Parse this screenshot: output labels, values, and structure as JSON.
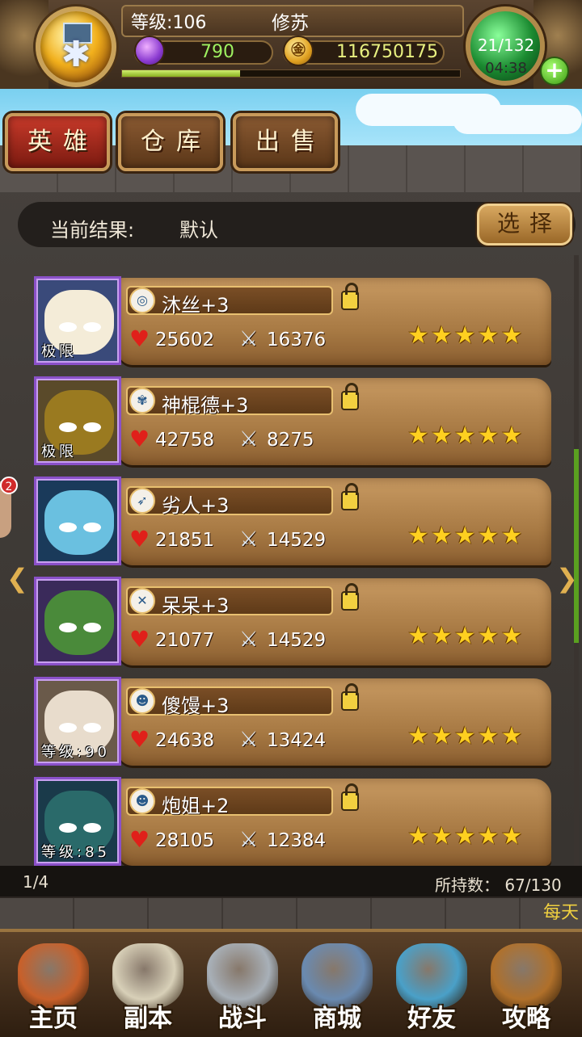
{
  "header": {
    "level_text": "等级:106",
    "player_name": "修苏",
    "gems": "790",
    "gold": "116750175",
    "gold_symbol": "㊎",
    "exp_fraction": 0.35,
    "stamina": "21/132",
    "stamina_timer": "04:38",
    "plus_label": "+",
    "medal_icon": "snowflake-medal-icon"
  },
  "tabs": [
    {
      "label": "英雄",
      "active": true
    },
    {
      "label": "仓库",
      "active": false
    },
    {
      "label": "出售",
      "active": false
    }
  ],
  "filter": {
    "label": "当前结果:",
    "value": "默认",
    "select_label": "选择"
  },
  "heroes": [
    {
      "name": "沐丝+3",
      "hp": "25602",
      "atk": "16376",
      "stars": "★★★★★",
      "tag": "极限",
      "class_icon": "spirit-icon",
      "class_glyph": "◎",
      "face_color": "#f4ecd8",
      "bg_color": "#3a4a7a"
    },
    {
      "name": "神棍德+3",
      "hp": "42758",
      "atk": "8275",
      "stars": "★★★★★",
      "tag": "极限",
      "class_icon": "paw-icon",
      "class_glyph": "✾",
      "face_color": "#9a7a20",
      "bg_color": "#5a4a2a"
    },
    {
      "name": "劣人+3",
      "hp": "21851",
      "atk": "14529",
      "stars": "★★★★★",
      "tag": "",
      "class_icon": "bow-icon",
      "class_glyph": "➶",
      "face_color": "#6ac0e0",
      "bg_color": "#1a3a5a"
    },
    {
      "name": "呆呆+3",
      "hp": "21077",
      "atk": "14529",
      "stars": "★★★★★",
      "tag": "",
      "class_icon": "crossed-swords-icon",
      "class_glyph": "✕",
      "face_color": "#4a8a3a",
      "bg_color": "#3a2a5a"
    },
    {
      "name": "傻馒+3",
      "hp": "24638",
      "atk": "13424",
      "stars": "★★★★★",
      "tag": "等级:90",
      "class_icon": "skull-icon",
      "class_glyph": "☻",
      "face_color": "#e8dccc",
      "bg_color": "#6a5a4a"
    },
    {
      "name": "炮姐+2",
      "hp": "28105",
      "atk": "12384",
      "stars": "★★★★★",
      "tag": "等级:85",
      "class_icon": "skull-icon",
      "class_glyph": "☻",
      "face_color": "#2a6a6a",
      "bg_color": "#1a3a4a"
    }
  ],
  "pager": {
    "page": "1/4",
    "hold_count": "所持数： 67/130"
  },
  "side_badge": "2",
  "arrows": {
    "left": "❮",
    "right": "❯"
  },
  "daily_text": "每天",
  "bottom_nav": [
    {
      "label": "主页",
      "icon": "house-icon",
      "color": "#c8602a"
    },
    {
      "label": "副本",
      "icon": "skull-orb-icon",
      "color": "#d8d0b8"
    },
    {
      "label": "战斗",
      "icon": "sword-axe-icon",
      "color": "#a8b0b8"
    },
    {
      "label": "商城",
      "icon": "monster-shop-icon",
      "color": "#6a8ab0"
    },
    {
      "label": "好友",
      "icon": "friends-icon",
      "color": "#4aa0c8"
    },
    {
      "label": "攻略",
      "icon": "book-icon",
      "color": "#b0702a"
    }
  ],
  "colors": {
    "accent": "#c83a2a",
    "gem_text": "#9ef060",
    "gold_text": "#e8f080",
    "star": "#ffd020",
    "heart": "#e0201a"
  }
}
